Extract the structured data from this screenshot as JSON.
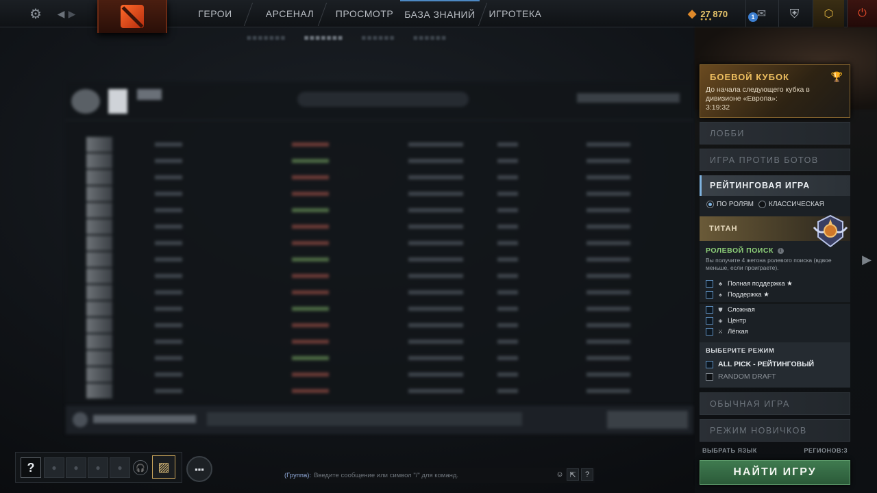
{
  "topbar": {
    "nav": [
      "ГЕРОИ",
      "АРСЕНАЛ",
      "ПРОСМОТР",
      "БАЗА ЗНАНИЙ",
      "ИГРОТЕКА"
    ],
    "currency": "27 870",
    "notifications_count": "1",
    "icons": {
      "settings": "gear-icon",
      "back": "chevron-left-icon",
      "forward": "chevron-right-icon",
      "mail": "mail-icon",
      "armory": "shield-icon",
      "plus": "plus-hex-icon",
      "power": "power-icon"
    }
  },
  "battle_cup": {
    "title": "БОЕВОЙ КУБОК",
    "description": "До начала следующего кубка в дивизионе «Европа»:",
    "timer": "3:19:32"
  },
  "modes": {
    "lobby": "ЛОББИ",
    "bots": "ИГРА ПРОТИВ БОТОВ",
    "ranked": "РЕЙТИНГОВАЯ ИГРА",
    "unranked": "ОБЫЧНАЯ ИГРА",
    "newbie": "РЕЖИМ НОВИЧКОВ"
  },
  "ranked": {
    "radio_roles": "ПО РОЛЯМ",
    "radio_classic": "КЛАССИЧЕСКАЯ",
    "rank_name": "ТИТАН",
    "role_search_title": "РОЛЕВОЙ ПОИСК",
    "role_search_desc": "Вы получите 4 жетона ролевого поиска (вдвое меньше, если проиграете).",
    "roles_star": [
      "Полная поддержка ★",
      "Поддержка ★"
    ],
    "roles": [
      "Сложная",
      "Центр",
      "Лёгкая"
    ],
    "select_mode_title": "ВЫБЕРИТЕ РЕЖИМ",
    "mode_all_pick": "ALL PICK - РЕЙТИНГОВЫЙ",
    "mode_random_draft": "RANDOM DRAFT"
  },
  "footer": {
    "language": "ВЫБРАТЬ ЯЗЫК",
    "regions": "РЕГИОНОВ:3",
    "find_game": "НАЙТИ ИГРУ"
  },
  "chat": {
    "group_label": "(Группа):",
    "placeholder": "Введите сообщение или символ \"/\" для команд."
  },
  "colors": {
    "accent": "#7fb3e0",
    "gold": "#f0c060",
    "green": "#8fd27a",
    "find_button": "#3f7a4f"
  }
}
